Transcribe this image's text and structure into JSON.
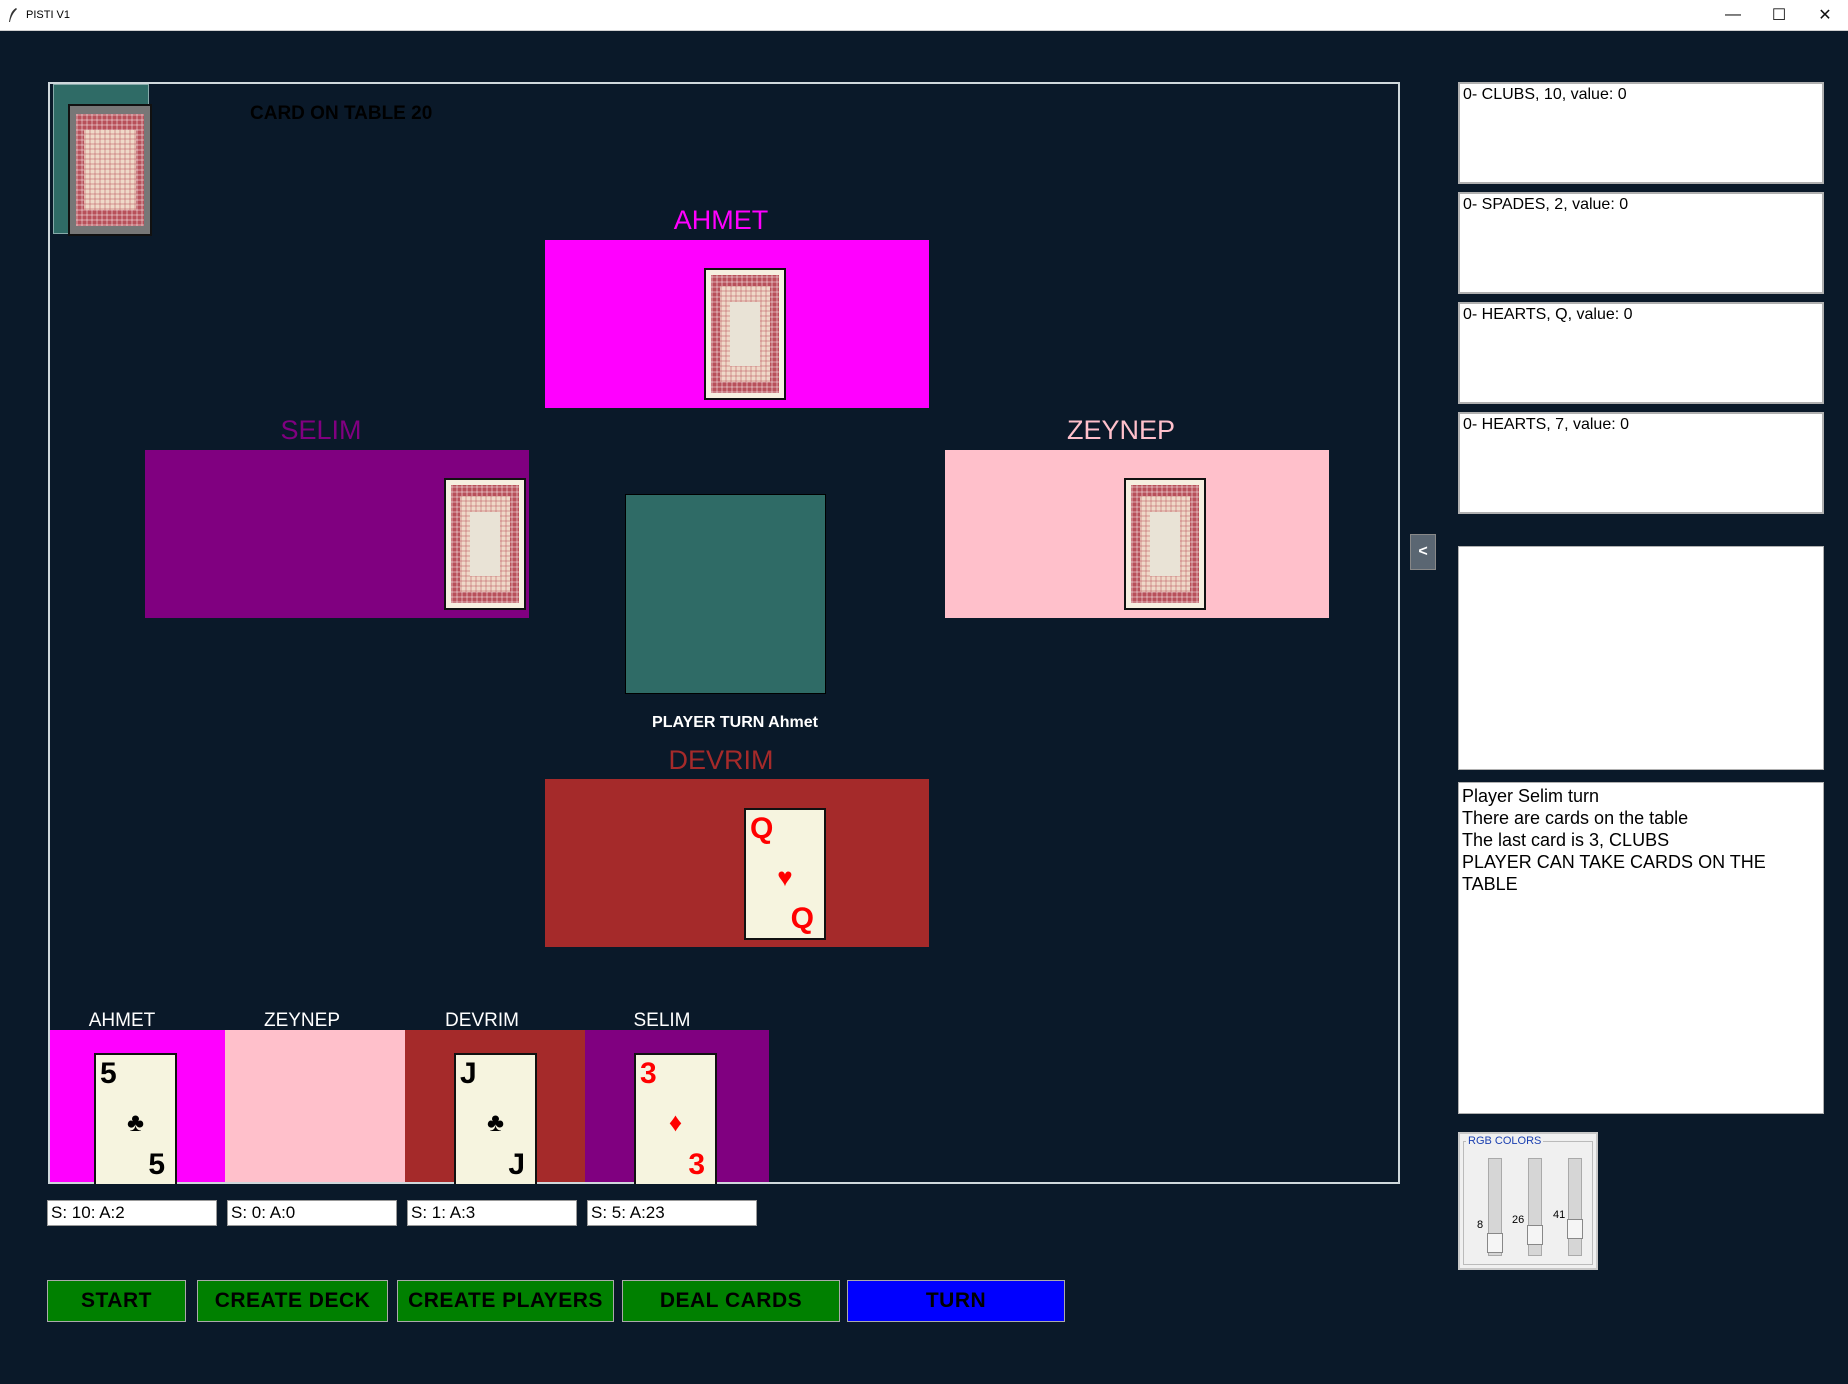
{
  "window": {
    "title": "PISTI V1",
    "minimize": "—",
    "maximize": "☐",
    "close": "✕"
  },
  "table": {
    "card_count_label": "CARD ON TABLE 20",
    "turn_label": "PLAYER TURN Ahmet"
  },
  "players": {
    "top": {
      "name": "AHMET",
      "color": "#ff00ff"
    },
    "left": {
      "name": "SELIM",
      "color": "#800080"
    },
    "right": {
      "name": "ZEYNEP",
      "color": "#ffc0cb"
    },
    "bottom": {
      "name": "DEVRIM",
      "color": "#a52a2a"
    }
  },
  "played": {
    "devrim_card": {
      "rank": "Q",
      "suit": "♥",
      "color": "#ff0000"
    }
  },
  "piles": [
    {
      "name": "AHMET",
      "color": "#ff00ff",
      "card": {
        "rank": "5",
        "suit": "♣",
        "color": "#000000"
      },
      "score": "S: 10: A:2"
    },
    {
      "name": "ZEYNEP",
      "color": "#ffc0cb",
      "card": null,
      "score": "S: 0: A:0"
    },
    {
      "name": "DEVRIM",
      "color": "#a52a2a",
      "card": {
        "rank": "J",
        "suit": "♣",
        "color": "#000000"
      },
      "score": "S: 1: A:3"
    },
    {
      "name": "SELIM",
      "color": "#800080",
      "card": {
        "rank": "3",
        "suit": "♦",
        "color": "#ff0000"
      },
      "score": "S: 5: A:23"
    }
  ],
  "buttons": {
    "start": "START",
    "create_deck": "CREATE DECK",
    "create_players": "CREATE PLAYERS",
    "deal_cards": "DEAL CARDS",
    "turn": "TURN"
  },
  "side": {
    "collapse": "<",
    "hands": [
      "0- CLUBS,   10, value: 0",
      "0- SPADES,   2, value: 0",
      "0- HEARTS,   Q, value: 0",
      "0- HEARTS,   7, value: 0"
    ],
    "log": [
      "Player Selim turn",
      "There are cards on the table",
      "The last card is 3, CLUBS",
      "PLAYER CAN TAKE CARDS ON THE TABLE"
    ]
  },
  "rgb": {
    "legend": "RGB COLORS",
    "r": "8",
    "g": "26",
    "b": "41"
  },
  "colors": {
    "background": "#0a1929",
    "table_pile": "#2f6b66",
    "button_green": "#008000",
    "button_turn": "#0000ff"
  }
}
